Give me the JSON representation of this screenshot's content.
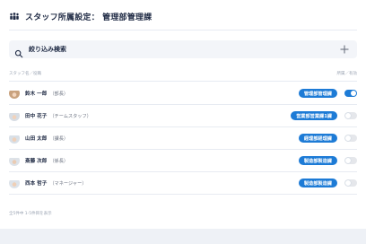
{
  "header": {
    "title": "スタッフ所属設定： 管理部管理課"
  },
  "search": {
    "label": "絞り込み検索"
  },
  "table": {
    "col_left": "スタッフ名／役職",
    "col_right": "所属／有効",
    "rows": [
      {
        "name": "鈴木 一郎",
        "role": "（部長）",
        "dept": "管理部管理課",
        "active": true,
        "avatar_bg": "#c9a27e"
      },
      {
        "name": "田中 花子",
        "role": "（チームスタッフ）",
        "dept": "営業部営業課1課",
        "active": false,
        "avatar_bg": "#7f8c9a"
      },
      {
        "name": "山田 太郎",
        "role": "（課長）",
        "dept": "経理部経理課",
        "active": false,
        "avatar_bg": "#5a6b7b"
      },
      {
        "name": "斎藤 次郎",
        "role": "（係長）",
        "dept": "製造部製造課",
        "active": false,
        "avatar_bg": "#8f7f6f"
      },
      {
        "name": "西本 哲子",
        "role": "（マネージャー）",
        "dept": "製造部製造課",
        "active": false,
        "avatar_bg": "#5f6f7f"
      }
    ]
  },
  "footer": {
    "text": "全5件中 1-5件目を表示"
  },
  "colors": {
    "accent": "#1d7bd6",
    "text": "#1f2a44",
    "muted": "#9aa3b2"
  }
}
